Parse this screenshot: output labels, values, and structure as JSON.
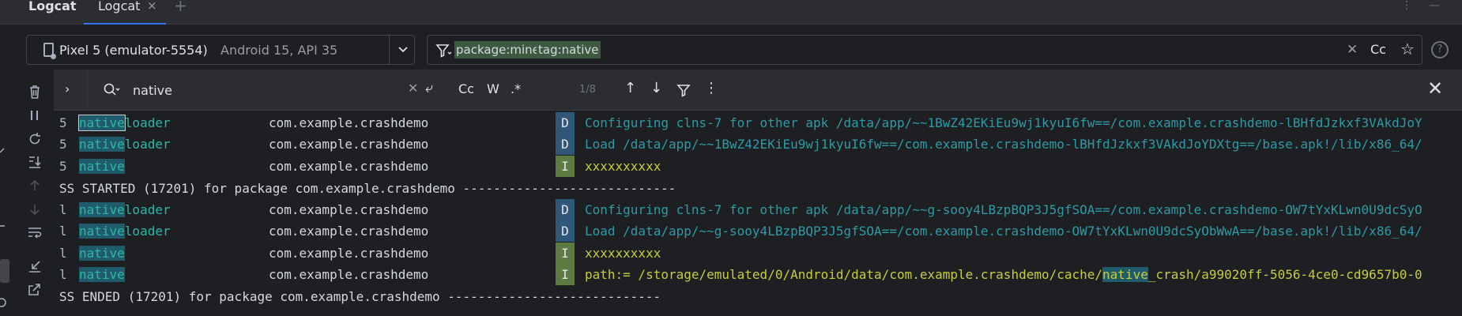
{
  "title_bar": {
    "app_title": "Logcat",
    "tab_label": "Logcat",
    "close_glyph": "×",
    "add_glyph": "+"
  },
  "device": {
    "name": "Pixel 5 (emulator-5554)",
    "detail": "Android 15, API 35"
  },
  "filter": {
    "chips": [
      "package:mine",
      "tag:native"
    ],
    "case_label": "Cc"
  },
  "find": {
    "query": "native",
    "options": [
      "Cc",
      "W",
      ".*"
    ],
    "match_count": "1/8"
  },
  "log": {
    "rows": [
      {
        "kind": "entry",
        "pid": "5",
        "tag_match": "native",
        "tag_rest": "loader",
        "package": "com.example.crashdemo",
        "level": "D",
        "message": "Configuring clns-7 for other apk /data/app/~~1BwZ42EKiEu9wj1kyuI6fw==/com.example.crashdemo-lBHfdJzkxf3VAkdJoY",
        "current": true
      },
      {
        "kind": "entry",
        "pid": "5",
        "tag_match": "native",
        "tag_rest": "loader",
        "package": "com.example.crashdemo",
        "level": "D",
        "message": "Load /data/app/~~1BwZ42EKiEu9wj1kyuI6fw==/com.example.crashdemo-lBHfdJzkxf3VAkdJoYDXtg==/base.apk!/lib/x86_64/"
      },
      {
        "kind": "entry",
        "pid": "5",
        "tag_match": "native",
        "tag_rest": "",
        "package": "com.example.crashdemo",
        "level": "I",
        "message": "xxxxxxxxxx"
      },
      {
        "kind": "process",
        "text": "SS STARTED (17201) for package com.example.crashdemo ----------------------------"
      },
      {
        "kind": "entry",
        "pid": "l",
        "tag_match": "native",
        "tag_rest": "loader",
        "package": "com.example.crashdemo",
        "level": "D",
        "message": "Configuring clns-7 for other apk /data/app/~~g-sooy4LBzpBQP3J5gfSOA==/com.example.crashdemo-OW7tYxKLwn0U9dcSyO"
      },
      {
        "kind": "entry",
        "pid": "l",
        "tag_match": "native",
        "tag_rest": "loader",
        "package": "com.example.crashdemo",
        "level": "D",
        "message": "Load /data/app/~~g-sooy4LBzpBQP3J5gfSOA==/com.example.crashdemo-OW7tYxKLwn0U9dcSyObWwA==/base.apk!/lib/x86_64/"
      },
      {
        "kind": "entry",
        "pid": "l",
        "tag_match": "native",
        "tag_rest": "",
        "package": "com.example.crashdemo",
        "level": "I",
        "message": "xxxxxxxxxx"
      },
      {
        "kind": "entry",
        "pid": "l",
        "tag_match": "native",
        "tag_rest": "",
        "package": "com.example.crashdemo",
        "level": "I",
        "message_pre": "path:= /storage/emulated/0/Android/data/com.example.crashdemo/cache/",
        "message_match": "native",
        "message_post": "_crash/a99020ff-5056-4ce0-cd9657b0-0"
      },
      {
        "kind": "process",
        "text": "SS ENDED (17201) for package com.example.crashdemo ----------------------------"
      }
    ]
  },
  "icons": {
    "left_toolbar": [
      "trash-icon",
      "pause-icon",
      "restart-icon",
      "scroll-to-end-icon",
      "up-arrow-icon",
      "down-arrow-icon",
      "soft-wrap-icon",
      "import-icon",
      "export-icon"
    ]
  }
}
